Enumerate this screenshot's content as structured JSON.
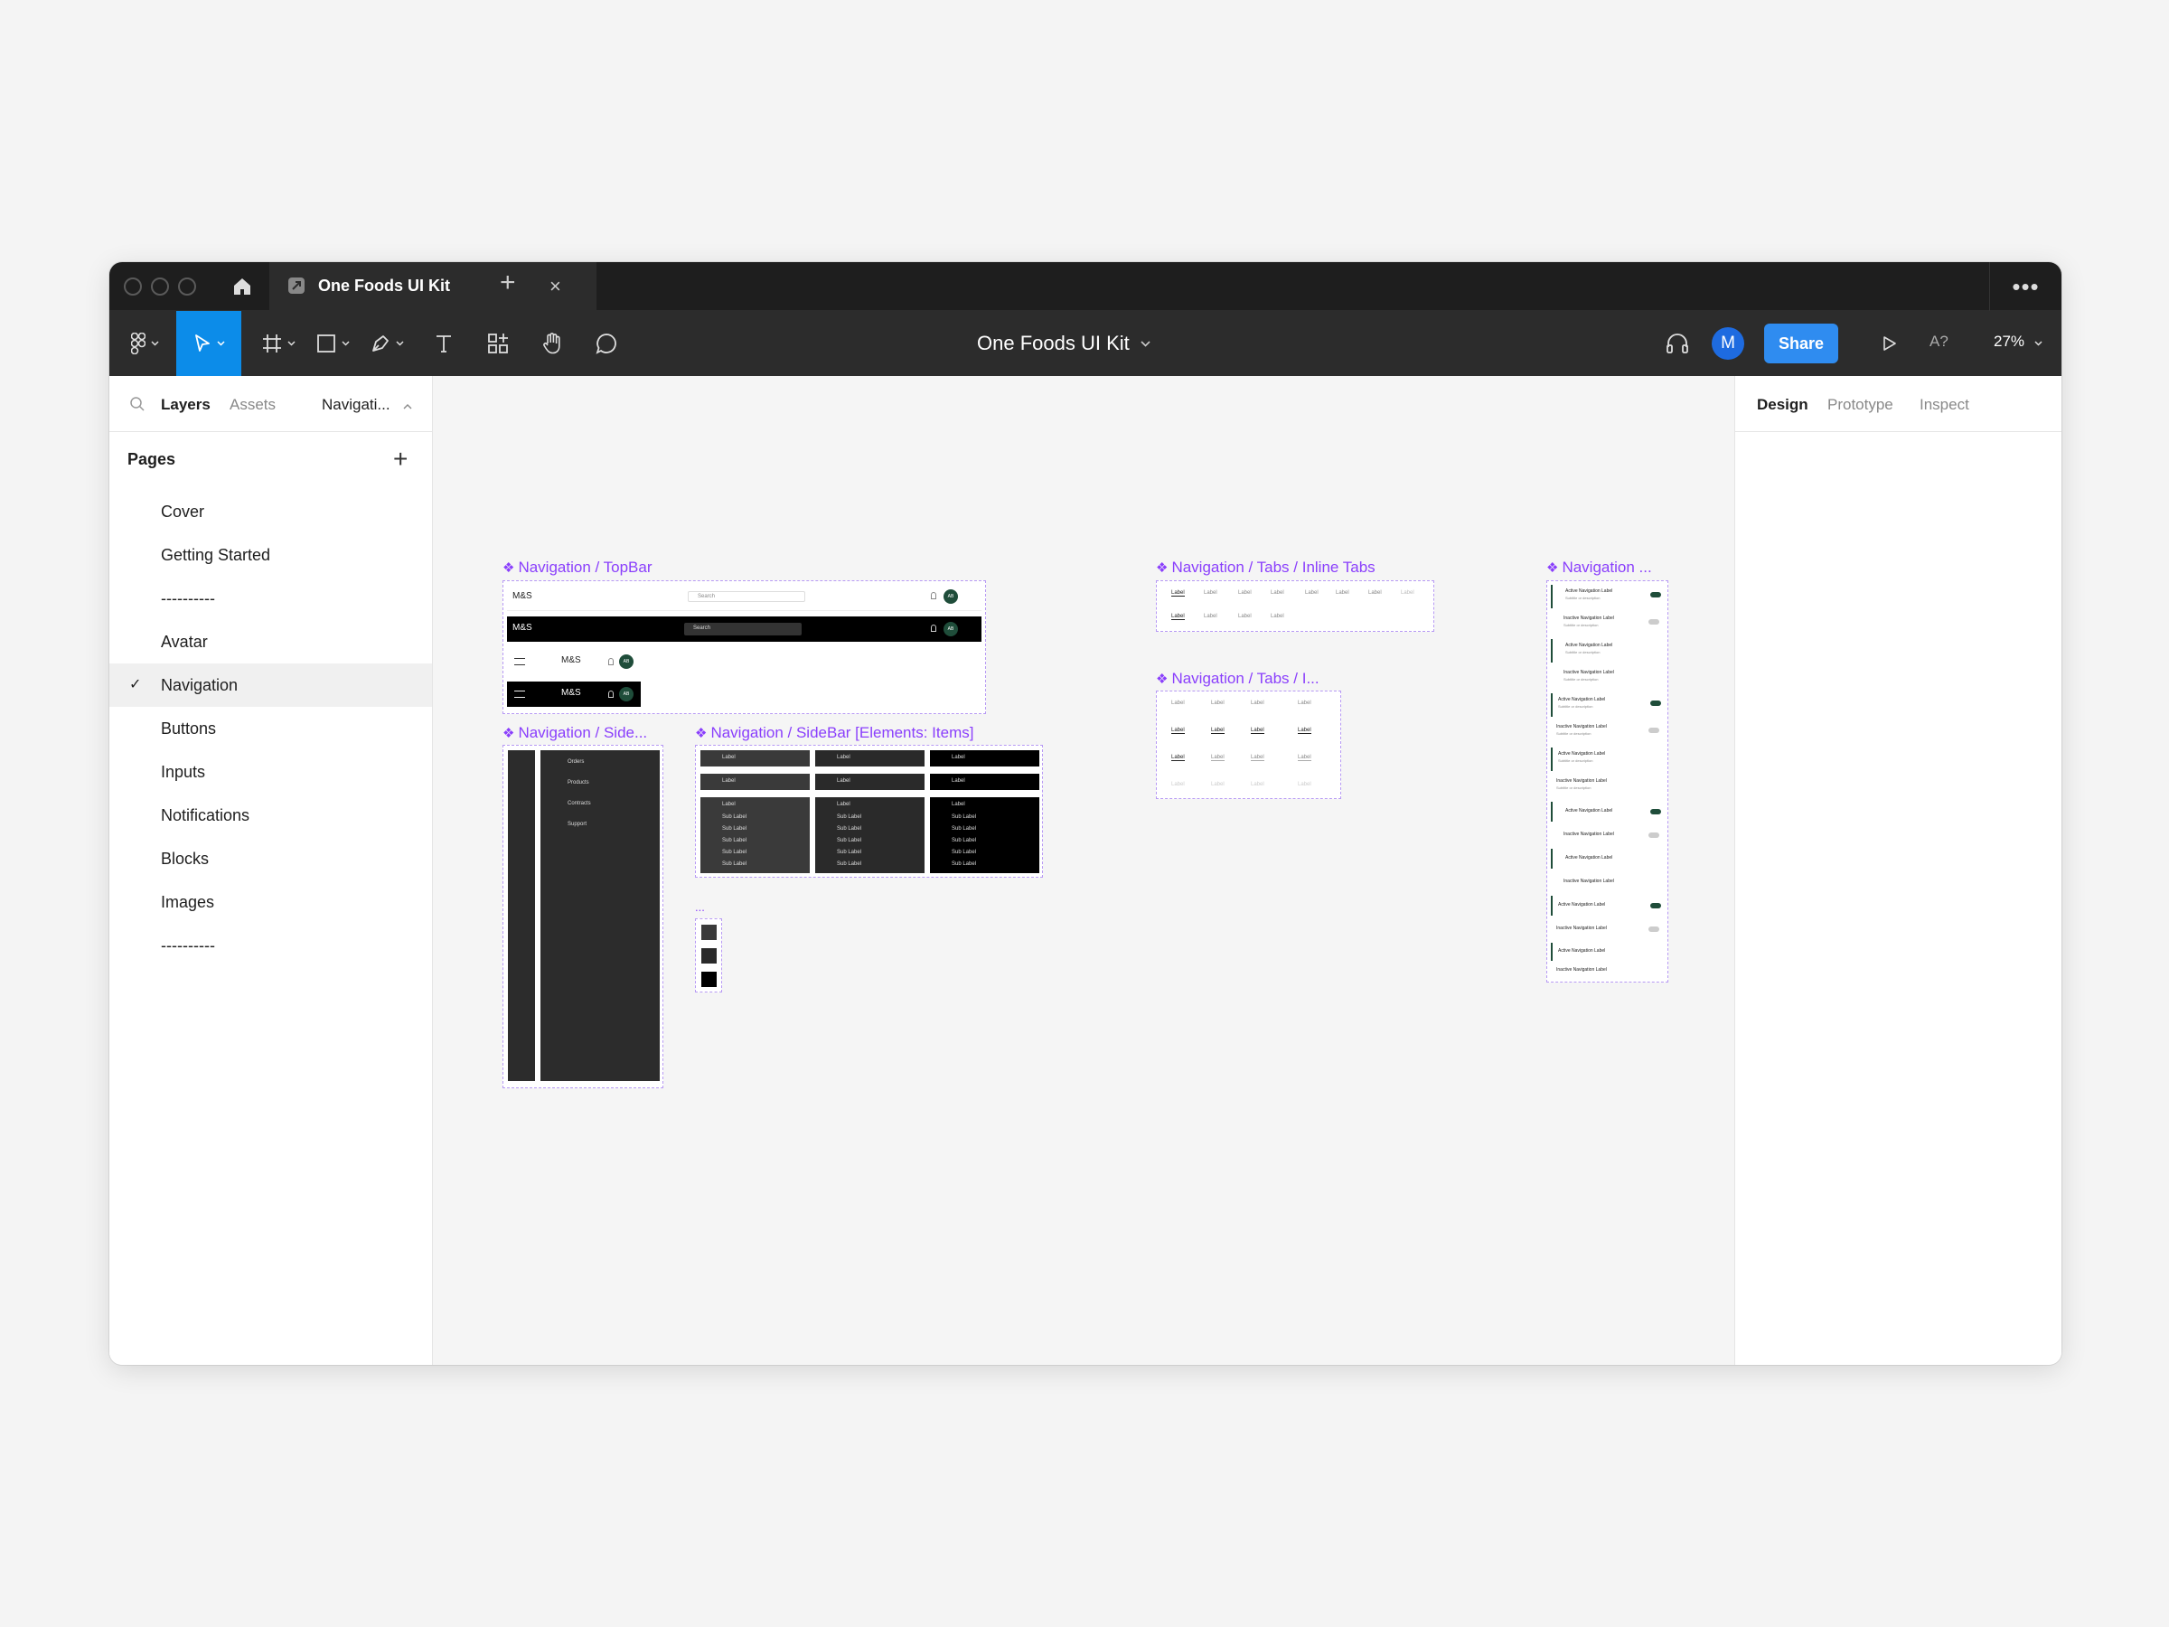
{
  "window": {
    "tab_title": "One Foods UI Kit",
    "tab_close": "×",
    "new_tab": "+",
    "more": "•••"
  },
  "toolbar": {
    "document_title": "One Foods UI Kit",
    "avatar_initial": "M",
    "share_label": "Share",
    "font_missing": "A?",
    "zoom": "27%"
  },
  "left_panel": {
    "tabs": [
      "Layers",
      "Assets"
    ],
    "page_selector": "Navigati...",
    "pages_heading": "Pages",
    "add_page": "+",
    "pages": [
      "Cover",
      "Getting Started",
      "----------",
      "Avatar",
      "Navigation",
      "Buttons",
      "Inputs",
      "Notifications",
      "Blocks",
      "Images",
      "----------"
    ],
    "selected_page": "Navigation"
  },
  "right_panel": {
    "tabs": [
      "Design",
      "Prototype",
      "Inspect"
    ]
  },
  "canvas": {
    "frames": {
      "topbar": "Navigation / TopBar",
      "sidebar": "Navigation / Side...",
      "sidebar_items": "Navigation / SideBar [Elements: Items]",
      "inline_tabs": "Navigation / Tabs / Inline Tabs",
      "tabs2": "Navigation / Tabs / I...",
      "nav_list": "Navigation ...",
      "dots": "..."
    },
    "topbar": {
      "logo": "M&S",
      "search": "Search",
      "avatar": "AB"
    },
    "sidebar_menu": [
      "Orders",
      "Products",
      "Contracts",
      "Support"
    ],
    "item_label": "Label",
    "sub_label": "Sub Label",
    "tab_label": "Label",
    "nav_list": {
      "active": "Active Navigation Label",
      "inactive": "Inactive Navigation Label",
      "desc": "Subtitle or description"
    }
  }
}
